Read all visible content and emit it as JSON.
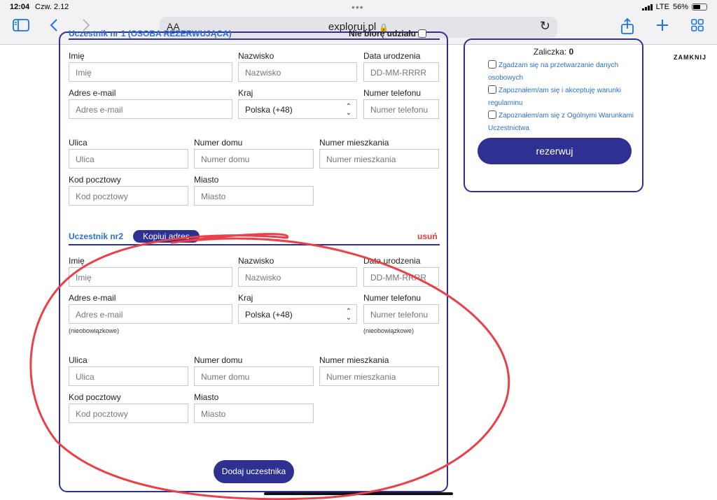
{
  "status_bar": {
    "time": "12:04",
    "date": "Czw. 2.12",
    "network": "LTE",
    "battery": "56%"
  },
  "browser": {
    "aa_label": "AA",
    "url": "exploruj.pl"
  },
  "top_section": {
    "participant_label": "Uczestnik nr 1 (OSOBA REZERWUJĄCA)",
    "not_participating": "Nie biorę udziału"
  },
  "labels": {
    "first_name": "Imię",
    "last_name": "Nazwisko",
    "birth_date": "Data urodzenia",
    "email": "Adres e-mail",
    "country": "Kraj",
    "phone": "Numer telefonu",
    "street": "Ulica",
    "house": "Numer domu",
    "apartment": "Numer mieszkania",
    "postal": "Kod pocztowy",
    "city": "Miasto"
  },
  "placeholders": {
    "first_name": "Imię",
    "last_name": "Nazwisko",
    "birth_date": "DD-MM-RRRR",
    "email": "Adres e-mail",
    "phone": "Numer telefonu",
    "street": "Ulica",
    "house": "Numer domu",
    "apartment": "Numer mieszkania",
    "postal": "Kod pocztowy",
    "city": "Miasto"
  },
  "country_value": "Polska (+48)",
  "participant2": {
    "title": "Uczestnik nr2",
    "copy_address": "Kopiuj adres",
    "remove": "usuń",
    "optional": "(nieobowiązkowe)"
  },
  "add_participant": "Dodaj uczestnika",
  "sidebar": {
    "advance_label": "Zaliczka:",
    "advance_value": "0",
    "consents": [
      "Zgadzam się na przetwarzanie danych osobowych",
      "Zapoznałem/am się i akceptuję warunki regulaminu",
      "Zapoznałem/am się z Ogólnymi Warunkami Uczestnictwa"
    ],
    "reserve_button": "rezerwuj"
  },
  "close_label": "ZAMKNIJ",
  "colors": {
    "brand": "#2e3192",
    "link": "#2e6fcf",
    "danger": "#e23b3b",
    "annotation": "#e8414a"
  }
}
